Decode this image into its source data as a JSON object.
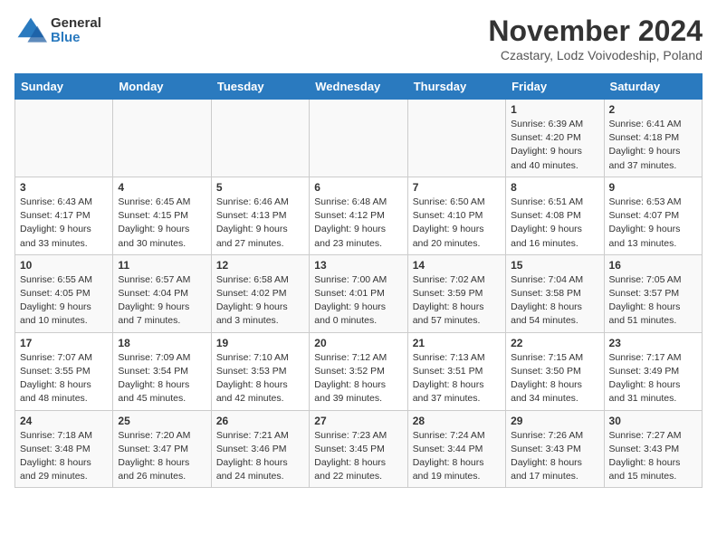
{
  "logo": {
    "general": "General",
    "blue": "Blue"
  },
  "title": "November 2024",
  "subtitle": "Czastary, Lodz Voivodeship, Poland",
  "days_of_week": [
    "Sunday",
    "Monday",
    "Tuesday",
    "Wednesday",
    "Thursday",
    "Friday",
    "Saturday"
  ],
  "weeks": [
    [
      {
        "day": "",
        "info": ""
      },
      {
        "day": "",
        "info": ""
      },
      {
        "day": "",
        "info": ""
      },
      {
        "day": "",
        "info": ""
      },
      {
        "day": "",
        "info": ""
      },
      {
        "day": "1",
        "info": "Sunrise: 6:39 AM\nSunset: 4:20 PM\nDaylight: 9 hours and 40 minutes."
      },
      {
        "day": "2",
        "info": "Sunrise: 6:41 AM\nSunset: 4:18 PM\nDaylight: 9 hours and 37 minutes."
      }
    ],
    [
      {
        "day": "3",
        "info": "Sunrise: 6:43 AM\nSunset: 4:17 PM\nDaylight: 9 hours and 33 minutes."
      },
      {
        "day": "4",
        "info": "Sunrise: 6:45 AM\nSunset: 4:15 PM\nDaylight: 9 hours and 30 minutes."
      },
      {
        "day": "5",
        "info": "Sunrise: 6:46 AM\nSunset: 4:13 PM\nDaylight: 9 hours and 27 minutes."
      },
      {
        "day": "6",
        "info": "Sunrise: 6:48 AM\nSunset: 4:12 PM\nDaylight: 9 hours and 23 minutes."
      },
      {
        "day": "7",
        "info": "Sunrise: 6:50 AM\nSunset: 4:10 PM\nDaylight: 9 hours and 20 minutes."
      },
      {
        "day": "8",
        "info": "Sunrise: 6:51 AM\nSunset: 4:08 PM\nDaylight: 9 hours and 16 minutes."
      },
      {
        "day": "9",
        "info": "Sunrise: 6:53 AM\nSunset: 4:07 PM\nDaylight: 9 hours and 13 minutes."
      }
    ],
    [
      {
        "day": "10",
        "info": "Sunrise: 6:55 AM\nSunset: 4:05 PM\nDaylight: 9 hours and 10 minutes."
      },
      {
        "day": "11",
        "info": "Sunrise: 6:57 AM\nSunset: 4:04 PM\nDaylight: 9 hours and 7 minutes."
      },
      {
        "day": "12",
        "info": "Sunrise: 6:58 AM\nSunset: 4:02 PM\nDaylight: 9 hours and 3 minutes."
      },
      {
        "day": "13",
        "info": "Sunrise: 7:00 AM\nSunset: 4:01 PM\nDaylight: 9 hours and 0 minutes."
      },
      {
        "day": "14",
        "info": "Sunrise: 7:02 AM\nSunset: 3:59 PM\nDaylight: 8 hours and 57 minutes."
      },
      {
        "day": "15",
        "info": "Sunrise: 7:04 AM\nSunset: 3:58 PM\nDaylight: 8 hours and 54 minutes."
      },
      {
        "day": "16",
        "info": "Sunrise: 7:05 AM\nSunset: 3:57 PM\nDaylight: 8 hours and 51 minutes."
      }
    ],
    [
      {
        "day": "17",
        "info": "Sunrise: 7:07 AM\nSunset: 3:55 PM\nDaylight: 8 hours and 48 minutes."
      },
      {
        "day": "18",
        "info": "Sunrise: 7:09 AM\nSunset: 3:54 PM\nDaylight: 8 hours and 45 minutes."
      },
      {
        "day": "19",
        "info": "Sunrise: 7:10 AM\nSunset: 3:53 PM\nDaylight: 8 hours and 42 minutes."
      },
      {
        "day": "20",
        "info": "Sunrise: 7:12 AM\nSunset: 3:52 PM\nDaylight: 8 hours and 39 minutes."
      },
      {
        "day": "21",
        "info": "Sunrise: 7:13 AM\nSunset: 3:51 PM\nDaylight: 8 hours and 37 minutes."
      },
      {
        "day": "22",
        "info": "Sunrise: 7:15 AM\nSunset: 3:50 PM\nDaylight: 8 hours and 34 minutes."
      },
      {
        "day": "23",
        "info": "Sunrise: 7:17 AM\nSunset: 3:49 PM\nDaylight: 8 hours and 31 minutes."
      }
    ],
    [
      {
        "day": "24",
        "info": "Sunrise: 7:18 AM\nSunset: 3:48 PM\nDaylight: 8 hours and 29 minutes."
      },
      {
        "day": "25",
        "info": "Sunrise: 7:20 AM\nSunset: 3:47 PM\nDaylight: 8 hours and 26 minutes."
      },
      {
        "day": "26",
        "info": "Sunrise: 7:21 AM\nSunset: 3:46 PM\nDaylight: 8 hours and 24 minutes."
      },
      {
        "day": "27",
        "info": "Sunrise: 7:23 AM\nSunset: 3:45 PM\nDaylight: 8 hours and 22 minutes."
      },
      {
        "day": "28",
        "info": "Sunrise: 7:24 AM\nSunset: 3:44 PM\nDaylight: 8 hours and 19 minutes."
      },
      {
        "day": "29",
        "info": "Sunrise: 7:26 AM\nSunset: 3:43 PM\nDaylight: 8 hours and 17 minutes."
      },
      {
        "day": "30",
        "info": "Sunrise: 7:27 AM\nSunset: 3:43 PM\nDaylight: 8 hours and 15 minutes."
      }
    ]
  ]
}
